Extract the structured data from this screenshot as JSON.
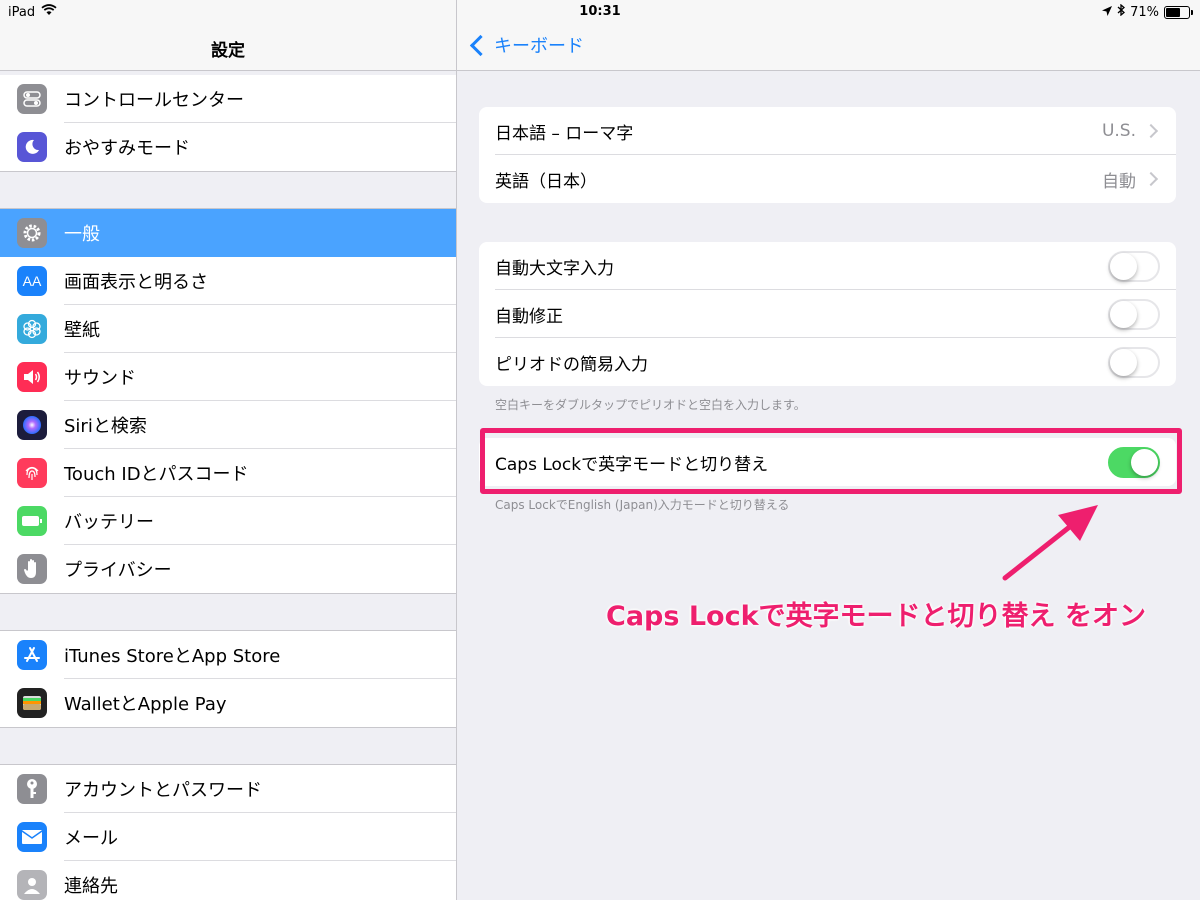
{
  "status_bar": {
    "device": "iPad",
    "time": "10:31",
    "battery_percent": "71%",
    "battery_level": 0.71
  },
  "left_pane": {
    "title": "設定",
    "groups": [
      {
        "items": [
          {
            "label": "コントロールセンター",
            "icon": "control-center-icon",
            "color": "#8e8e93"
          },
          {
            "label": "おやすみモード",
            "icon": "moon-icon",
            "color": "#5856d6"
          }
        ]
      },
      {
        "items": [
          {
            "label": "一般",
            "icon": "gear-icon",
            "color": "#8e8e93",
            "selected": true
          },
          {
            "label": "画面表示と明るさ",
            "icon": "display-brightness-icon",
            "color": "#1a82fb"
          },
          {
            "label": "壁紙",
            "icon": "wallpaper-flower-icon",
            "color": "#34aadc"
          },
          {
            "label": "サウンド",
            "icon": "speaker-icon",
            "color": "#ff2d55"
          },
          {
            "label": "Siriと検索",
            "icon": "siri-icon",
            "color": "#1c1c3c"
          },
          {
            "label": "Touch IDとパスコード",
            "icon": "fingerprint-icon",
            "color": "#ff3b5c"
          },
          {
            "label": "バッテリー",
            "icon": "battery-icon",
            "color": "#4cd964"
          },
          {
            "label": "プライバシー",
            "icon": "hand-icon",
            "color": "#8e8e93"
          }
        ]
      },
      {
        "items": [
          {
            "label": "iTunes StoreとApp Store",
            "icon": "app-store-icon",
            "color": "#1a82fb"
          },
          {
            "label": "WalletとApple Pay",
            "icon": "wallet-icon",
            "color": "#222222"
          }
        ]
      },
      {
        "items": [
          {
            "label": "アカウントとパスワード",
            "icon": "key-icon",
            "color": "#8e8e93"
          },
          {
            "label": "メール",
            "icon": "mail-icon",
            "color": "#1a82fb"
          },
          {
            "label": "連絡先",
            "icon": "contacts-icon",
            "color": "#b4b4b8"
          }
        ]
      }
    ]
  },
  "right_pane": {
    "back_label": "キーボード",
    "keyboards": [
      {
        "label": "日本語 – ローマ字",
        "value": "U.S."
      },
      {
        "label": "英語（日本）",
        "value": "自動"
      }
    ],
    "toggles": [
      {
        "label": "自動大文字入力",
        "on": false
      },
      {
        "label": "自動修正",
        "on": false
      },
      {
        "label": "ピリオドの簡易入力",
        "on": false
      }
    ],
    "toggles_footnote": "空白キーをダブルタップでピリオドと空白を入力します。",
    "caps_lock": {
      "label": "Caps Lockで英字モードと切り替え",
      "on": true
    },
    "caps_lock_footnote": "Caps LockでEnglish (Japan)入力モードと切り替える"
  },
  "annotation": {
    "text": "Caps Lockで英字モードと切り替え をオン",
    "color": "#ee1f6e"
  },
  "colors": {
    "accent": "#1a82fb",
    "selected_row": "#4aa3ff",
    "toggle_on": "#4cd964"
  }
}
